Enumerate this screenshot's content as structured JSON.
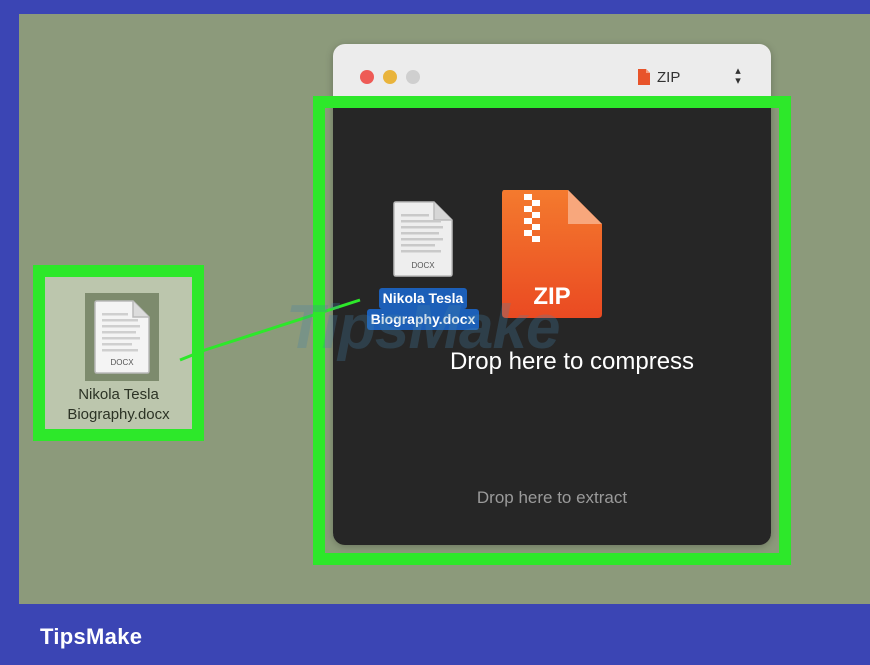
{
  "brand": {
    "name": "TipsMake"
  },
  "desktop_file": {
    "icon": "docx-file-icon",
    "icon_label": "DOCX",
    "name_line1": "Nikola Tesla",
    "name_line2": "Biography.docx"
  },
  "window": {
    "format_selector": {
      "icon": "zip-file-icon",
      "value": "ZIP"
    },
    "dragged_file": {
      "icon": "docx-file-icon",
      "icon_label": "DOCX",
      "name_line1": "Nikola Tesla",
      "name_line2": "Biography.docx"
    },
    "zip_icon_label": "ZIP",
    "compress_text": "Drop here to compress",
    "extract_text": "Drop here to extract"
  },
  "watermark": "TipsMake",
  "colors": {
    "highlight": "#2de82a",
    "frame": "#3b45b4",
    "desktop": "#8c9a7b",
    "drop_area": "#262626",
    "selection": "#1c5fb8",
    "zip_orange": "#f2572a"
  }
}
